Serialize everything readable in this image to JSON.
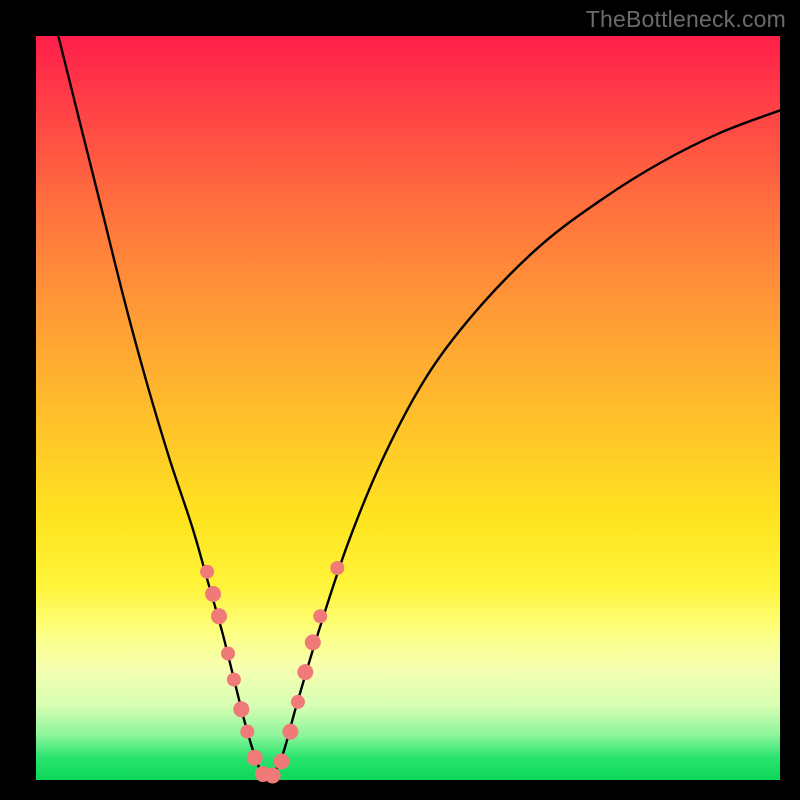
{
  "watermark": "TheBottleneck.com",
  "chart_data": {
    "type": "line",
    "title": "",
    "xlabel": "",
    "ylabel": "",
    "xlim": [
      0,
      100
    ],
    "ylim": [
      0,
      100
    ],
    "series": [
      {
        "name": "bottleneck-curve",
        "x": [
          3,
          6,
          9,
          12,
          15,
          18,
          21,
          23,
          25,
          26.5,
          28,
          29.5,
          31,
          33,
          35,
          38,
          42,
          47,
          53,
          60,
          68,
          76,
          84,
          92,
          100
        ],
        "y": [
          100,
          88,
          76,
          64,
          53,
          43,
          34,
          27,
          20,
          14,
          8,
          3,
          0,
          3,
          10,
          20,
          32,
          44,
          55,
          64,
          72,
          78,
          83,
          87,
          90
        ]
      }
    ],
    "markers": {
      "name": "sample-points",
      "color": "#ef7a78",
      "points": [
        {
          "x": 23.0,
          "y": 28.0,
          "r": 7
        },
        {
          "x": 23.8,
          "y": 25.0,
          "r": 8
        },
        {
          "x": 24.6,
          "y": 22.0,
          "r": 8
        },
        {
          "x": 25.8,
          "y": 17.0,
          "r": 7
        },
        {
          "x": 26.6,
          "y": 13.5,
          "r": 7
        },
        {
          "x": 27.6,
          "y": 9.5,
          "r": 8
        },
        {
          "x": 28.4,
          "y": 6.5,
          "r": 7
        },
        {
          "x": 29.4,
          "y": 3.0,
          "r": 8
        },
        {
          "x": 30.5,
          "y": 0.8,
          "r": 8
        },
        {
          "x": 31.8,
          "y": 0.6,
          "r": 8
        },
        {
          "x": 33.0,
          "y": 2.5,
          "r": 8
        },
        {
          "x": 34.2,
          "y": 6.5,
          "r": 8
        },
        {
          "x": 35.2,
          "y": 10.5,
          "r": 7
        },
        {
          "x": 36.2,
          "y": 14.5,
          "r": 8
        },
        {
          "x": 37.2,
          "y": 18.5,
          "r": 8
        },
        {
          "x": 38.2,
          "y": 22.0,
          "r": 7
        },
        {
          "x": 40.5,
          "y": 28.5,
          "r": 7
        }
      ]
    }
  }
}
